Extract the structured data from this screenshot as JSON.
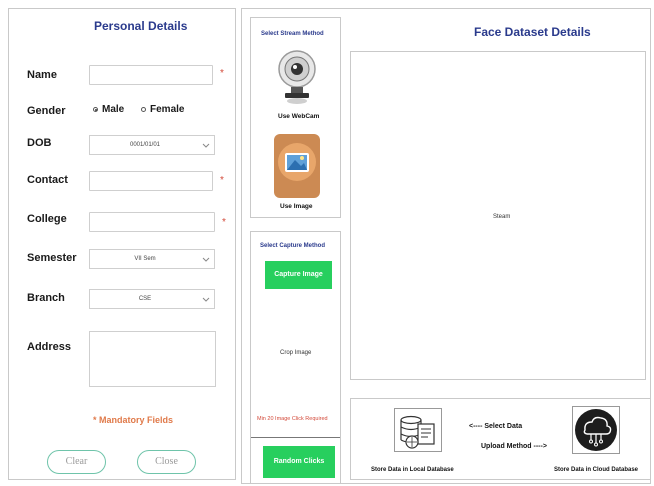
{
  "personal": {
    "title": "Personal Details",
    "fields": {
      "name": {
        "label": "Name",
        "value": ""
      },
      "gender": {
        "label": "Gender",
        "options": [
          "Male",
          "Female"
        ],
        "selected": "Male"
      },
      "dob": {
        "label": "DOB",
        "value": "0001/01/01"
      },
      "contact": {
        "label": "Contact",
        "value": ""
      },
      "college": {
        "label": "College",
        "value": ""
      },
      "semester": {
        "label": "Semester",
        "value": "VII Sem"
      },
      "branch": {
        "label": "Branch",
        "value": "CSE"
      },
      "address": {
        "label": "Address",
        "value": ""
      }
    },
    "required_mark": "*",
    "mandatory_note": "* Mandatory Fields",
    "clear_label": "Clear",
    "close_label": "Close"
  },
  "stream": {
    "title": "Select Stream Method",
    "webcam_label": "Use WebCam",
    "image_label": "Use Image"
  },
  "capture": {
    "title": "Select Capture Method",
    "capture_button": "Capture Image",
    "crop_label": "Crop Image",
    "min_note": "Min 20 Image Click Required",
    "random_button": "Random Clicks"
  },
  "dataset": {
    "title": "Face Dataset Details",
    "stream_placeholder": "Steam"
  },
  "upload": {
    "local_label": "Store Data in Local Database",
    "cloud_label": "Store Data in Cloud Database",
    "select_line1": "<---- Select Data",
    "select_line2": "Upload Method ---->"
  },
  "colors": {
    "title_blue": "#2a3a8c",
    "required_red": "#d34a3a",
    "mandatory_orange": "#e07a4a",
    "button_green": "#27cf5e",
    "pill_border": "#6fc4aa"
  }
}
